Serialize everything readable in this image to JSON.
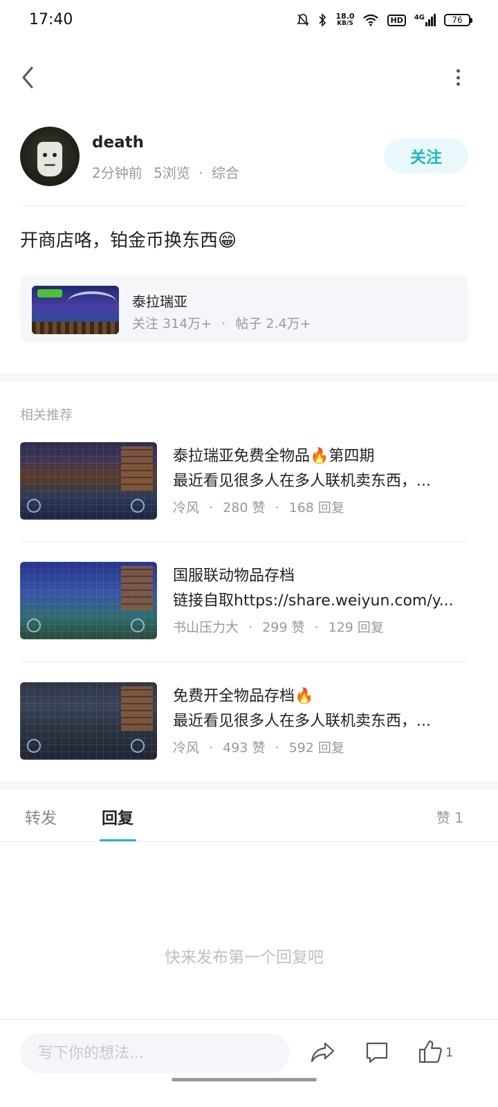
{
  "status_bar": {
    "time": "17:40",
    "speed_value": "18.0",
    "speed_unit": "KB/S",
    "hd": "HD",
    "network": "4G",
    "battery": "76"
  },
  "author": {
    "name": "death",
    "time_ago": "2分钟前",
    "views": "5浏览",
    "category": "综合",
    "follow_label": "关注"
  },
  "post": {
    "title": "开商店咯，铂金币换东西😁"
  },
  "game": {
    "name": "泰拉瑞亚",
    "followers": "关注 314万+",
    "posts": "帖子 2.4万+"
  },
  "recommended": {
    "heading": "相关推荐",
    "items": [
      {
        "title": "泰拉瑞亚免费全物品🔥第四期",
        "excerpt": "最近看见很多人在多人联机卖东西，...",
        "author": "冷风",
        "likes": "280 赞",
        "replies": "168 回复"
      },
      {
        "title": "国服联动物品存档",
        "excerpt": "链接自取https://share.weiyun.com/y...",
        "author": "书山压力大",
        "likes": "299 赞",
        "replies": "129 回复"
      },
      {
        "title": "免费开全物品存档🔥",
        "excerpt": "最近看见很多人在多人联机卖东西，...",
        "author": "冷风",
        "likes": "493 赞",
        "replies": "592 回复"
      }
    ]
  },
  "tabs": {
    "repost": "转发",
    "reply": "回复",
    "like_count": "赞 1"
  },
  "empty_hint": "快来发布第一个回复吧",
  "bottom_bar": {
    "input_placeholder": "写下你的想法...",
    "like_num": "1"
  },
  "colors": {
    "accent": "#23b5c4",
    "follow_bg": "#e8f8fb",
    "section_bg": "#f5f6fa"
  },
  "icons": [
    "back-arrow-icon",
    "more-dots-icon",
    "share-icon",
    "comment-icon",
    "thumbs-up-icon"
  ]
}
